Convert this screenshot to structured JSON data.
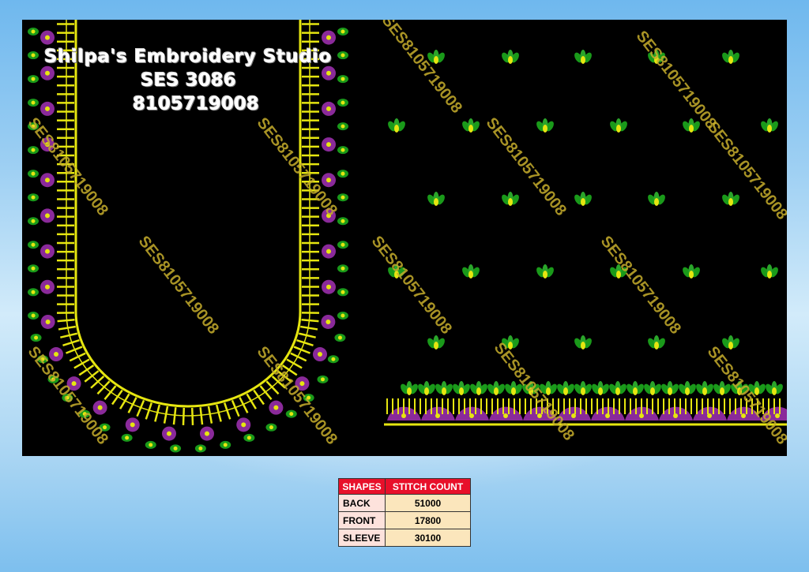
{
  "header": {
    "studio_name": "Shilpa's Embroidery Studio",
    "design_code": "SES 3086",
    "phone": "8105719008"
  },
  "watermark": "SES8105719008",
  "colors": {
    "canvas": "#000000",
    "thread_yellow": "#e6e610",
    "thread_purple": "#8a2a9a",
    "thread_green": "#1a9a1a",
    "table_header": "#e8102a",
    "table_shape_cell": "#fde2dc",
    "table_count_cell": "#fbe6bc"
  },
  "stitch_table": {
    "headers": [
      "SHAPES",
      "STITCH COUNT"
    ],
    "rows": [
      {
        "shape": "BACK",
        "count": "51000"
      },
      {
        "shape": "FRONT",
        "count": "17800"
      },
      {
        "shape": "SLEEVE",
        "count": "30100"
      }
    ]
  }
}
